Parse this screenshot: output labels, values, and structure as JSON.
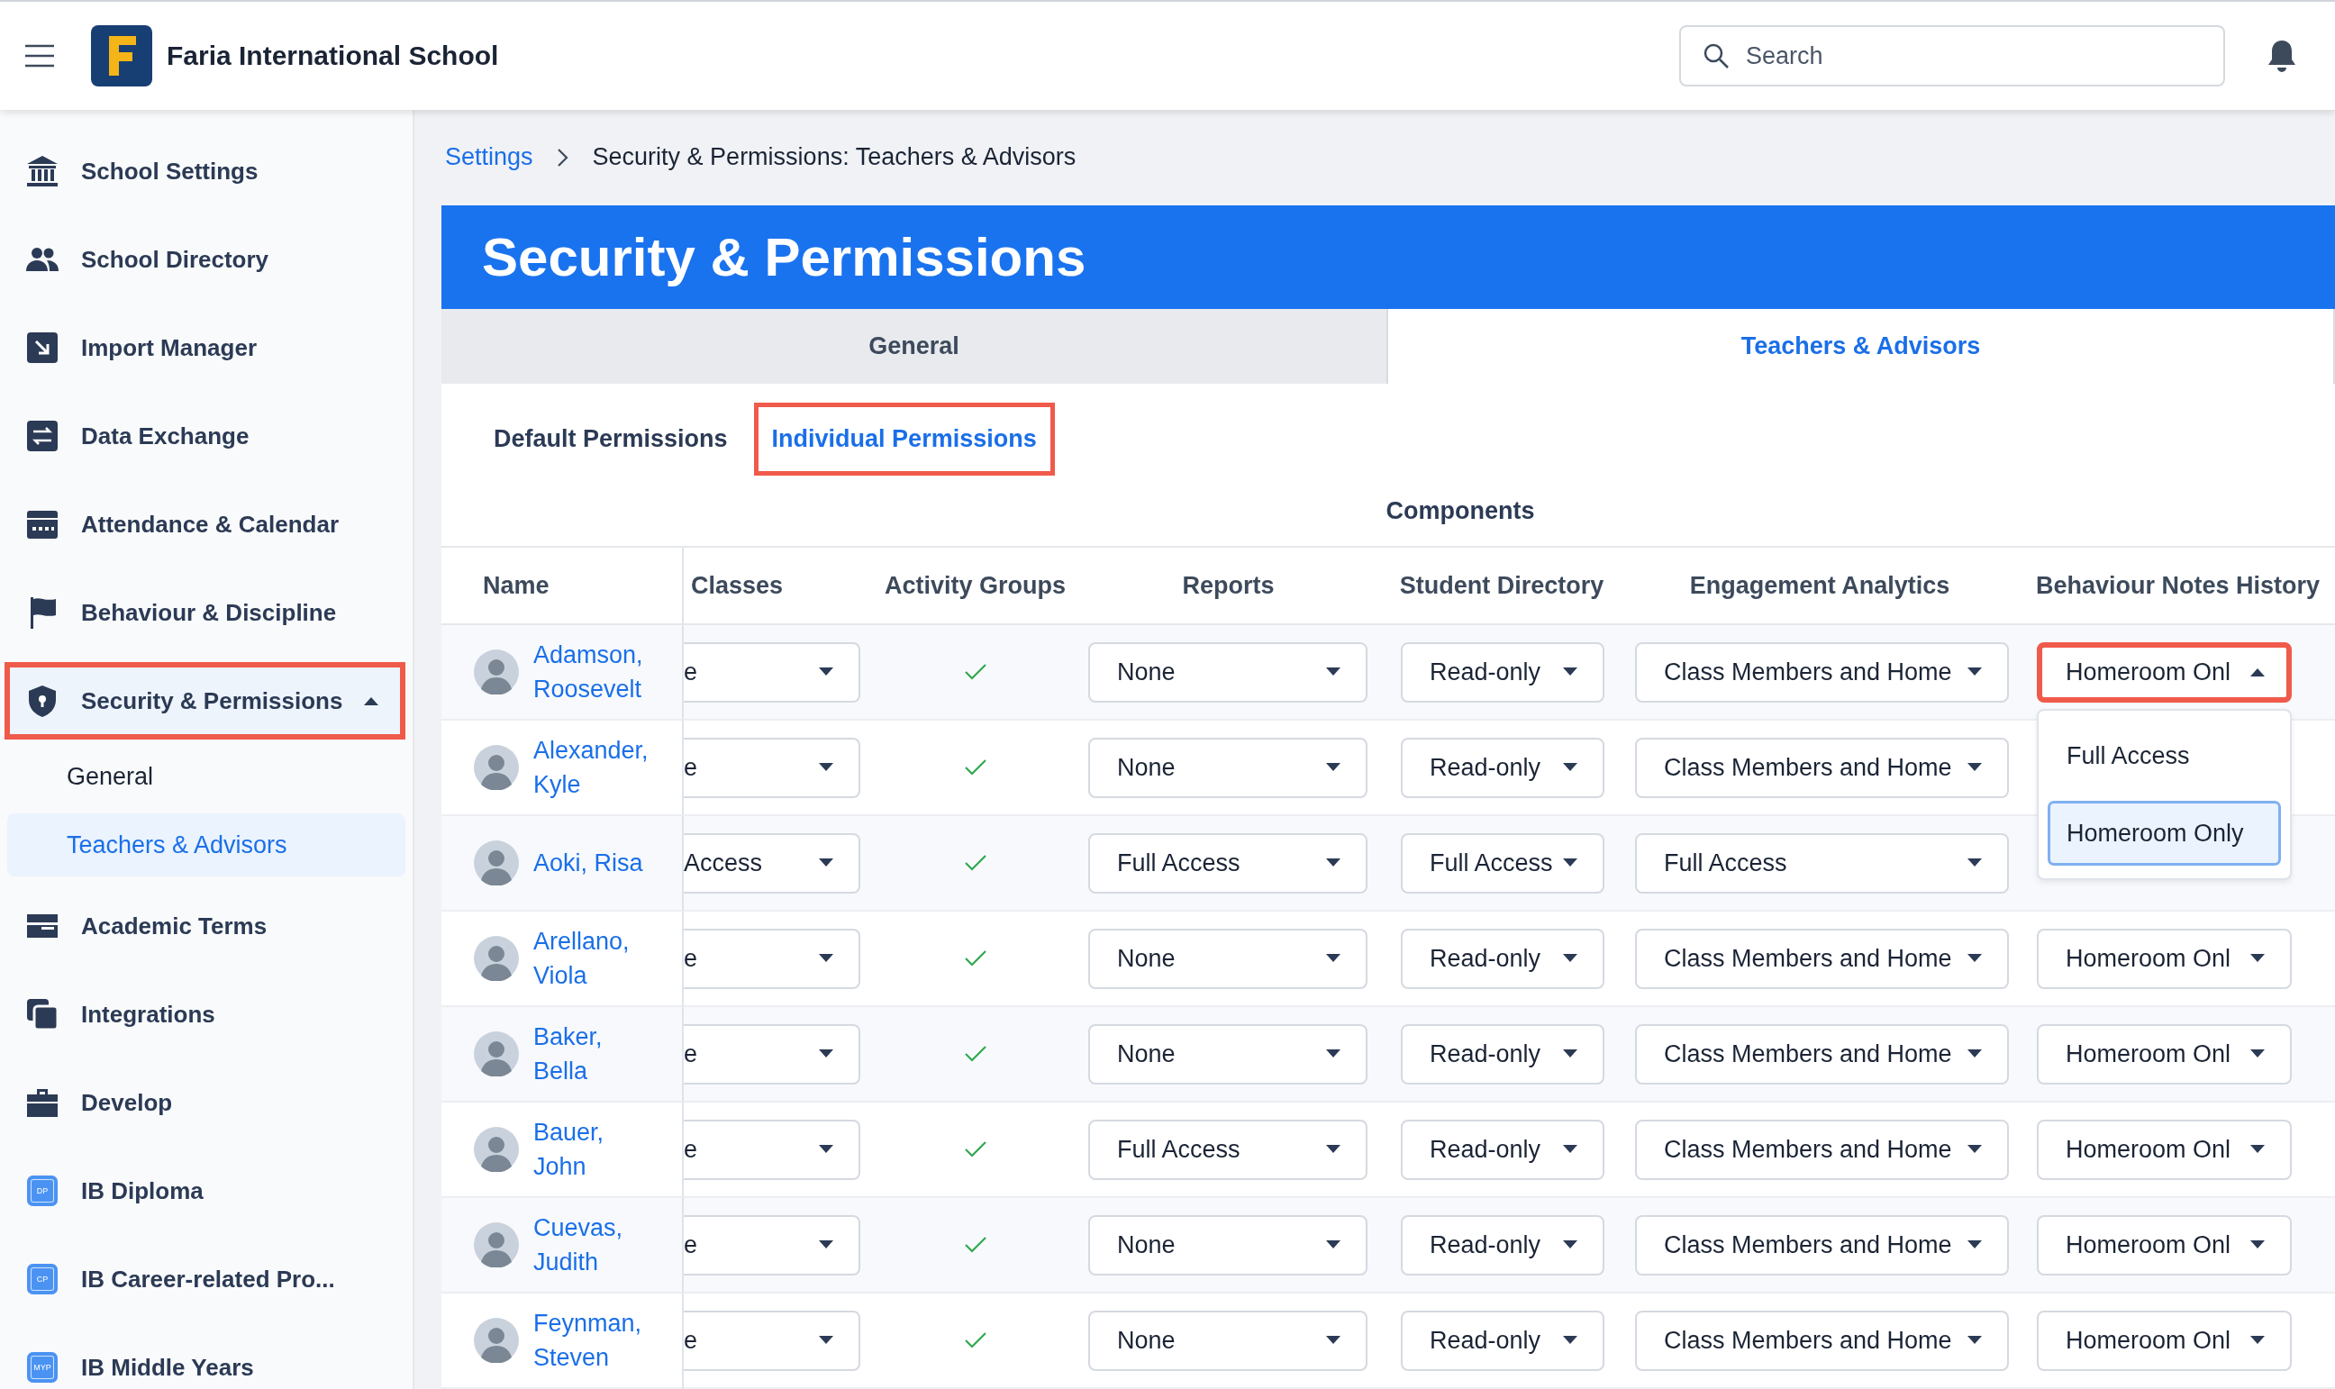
{
  "header": {
    "school_name": "Faria International School",
    "search": {
      "placeholder": "Search"
    }
  },
  "sidebar": {
    "items": [
      {
        "label": "School Settings",
        "highlighted": false
      },
      {
        "label": "School Directory",
        "highlighted": false
      },
      {
        "label": "Import Manager",
        "highlighted": false
      },
      {
        "label": "Data Exchange",
        "highlighted": false
      },
      {
        "label": "Attendance & Calendar",
        "highlighted": false
      },
      {
        "label": "Behaviour & Discipline",
        "highlighted": false
      },
      {
        "label": "Security & Permissions",
        "highlighted": true,
        "expanded": true,
        "children": [
          {
            "label": "General",
            "selected": false
          },
          {
            "label": "Teachers & Advisors",
            "selected": true
          }
        ]
      },
      {
        "label": "Academic Terms",
        "highlighted": false
      },
      {
        "label": "Integrations",
        "highlighted": false
      },
      {
        "label": "Develop",
        "highlighted": false
      },
      {
        "label": "IB Diploma",
        "highlighted": false,
        "badge": "DP"
      },
      {
        "label": "IB Career-related Pro...",
        "highlighted": false,
        "badge": "CP"
      },
      {
        "label": "IB Middle Years",
        "highlighted": false,
        "badge": "MYP"
      }
    ]
  },
  "breadcrumb": [
    {
      "label": "Settings",
      "kind": "link"
    },
    {
      "label": "Security & Permissions: Teachers & Advisors",
      "kind": "current"
    }
  ],
  "page": {
    "title": "Security & Permissions",
    "tabs": [
      {
        "label": "General",
        "selected": false
      },
      {
        "label": "Teachers & Advisors",
        "selected": true
      }
    ],
    "subtabs": [
      {
        "label": "Default Permissions",
        "selected": false,
        "highlighted": false
      },
      {
        "label": "Individual Permissions",
        "selected": true,
        "highlighted": true
      }
    ],
    "components_label": "Components",
    "table": {
      "columns": [
        "Name",
        "Classes",
        "Activity Groups",
        "Reports",
        "Student Directory",
        "Engagement Analytics",
        "Behaviour Notes History"
      ],
      "rows": [
        {
          "name": "Adamson, Roosevelt",
          "classes": "e",
          "activity_groups": true,
          "reports": "None",
          "student_directory": "Read-only",
          "engagement_analytics": "Class Members and Home",
          "behaviour_notes_history": {
            "value": "Homeroom Onl",
            "expanded": true,
            "highlighted": true,
            "options": [
              {
                "label": "Full Access",
                "selected": false
              },
              {
                "label": "Homeroom Only",
                "selected": true
              }
            ]
          }
        },
        {
          "name": "Alexander, Kyle",
          "classes": "e",
          "activity_groups": true,
          "reports": "None",
          "student_directory": "Read-only",
          "engagement_analytics": "Class Members and Home"
        },
        {
          "name": "Aoki, Risa",
          "classes": "Access",
          "activity_groups": true,
          "reports": "Full Access",
          "student_directory": "Full Access",
          "engagement_analytics": "Full Access"
        },
        {
          "name": "Arellano, Viola",
          "classes": "e",
          "activity_groups": true,
          "reports": "None",
          "student_directory": "Read-only",
          "engagement_analytics": "Class Members and Home",
          "behaviour_notes_history": {
            "value": "Homeroom Onl",
            "expanded": false,
            "highlighted": false
          }
        },
        {
          "name": "Baker, Bella",
          "classes": "e",
          "activity_groups": true,
          "reports": "None",
          "student_directory": "Read-only",
          "engagement_analytics": "Class Members and Home",
          "behaviour_notes_history": {
            "value": "Homeroom Onl",
            "expanded": false,
            "highlighted": false
          }
        },
        {
          "name": "Bauer, John",
          "classes": "e",
          "activity_groups": true,
          "reports": "Full Access",
          "student_directory": "Read-only",
          "engagement_analytics": "Class Members and Home",
          "behaviour_notes_history": {
            "value": "Homeroom Onl",
            "expanded": false,
            "highlighted": false
          }
        },
        {
          "name": "Cuevas, Judith",
          "classes": "e",
          "activity_groups": true,
          "reports": "None",
          "student_directory": "Read-only",
          "engagement_analytics": "Class Members and Home",
          "behaviour_notes_history": {
            "value": "Homeroom Onl",
            "expanded": false,
            "highlighted": false
          }
        },
        {
          "name": "Feynman, Steven",
          "classes": "e",
          "activity_groups": true,
          "reports": "None",
          "student_directory": "Read-only",
          "engagement_analytics": "Class Members and Home",
          "behaviour_notes_history": {
            "value": "Homeroom Onl",
            "expanded": false,
            "highlighted": false
          }
        }
      ]
    }
  }
}
